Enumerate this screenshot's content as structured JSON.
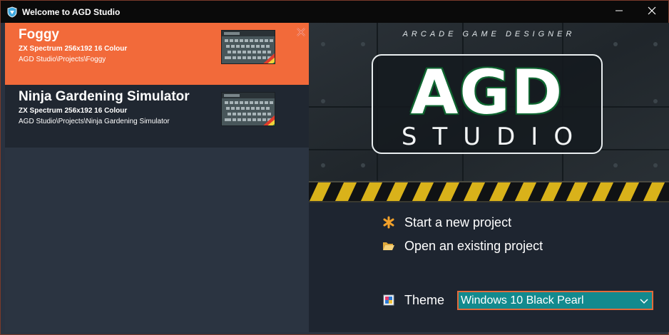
{
  "window": {
    "title": "Welcome to AGD Studio",
    "app_icon": "agd-shield-icon",
    "minimize_icon": "minimize-icon",
    "close_icon": "close-icon"
  },
  "projects": [
    {
      "name": "Foggy",
      "platform": "ZX Spectrum 256x192 16 Colour",
      "path": "AGD Studio\\Projects\\Foggy",
      "selected": true,
      "remove_icon": "remove-icon"
    },
    {
      "name": "Ninja Gardening Simulator",
      "platform": "ZX Spectrum 256x192 16 Colour",
      "path": "AGD Studio\\Projects\\Ninja Gardening Simulator",
      "selected": false
    }
  ],
  "banner": {
    "tagline": "ARCADE GAME DESIGNER",
    "logo_main": "AGD",
    "logo_sub": "STUDIO"
  },
  "actions": {
    "new_project": {
      "label": "Start a new project",
      "icon": "asterisk-icon"
    },
    "open_project": {
      "label": "Open an existing project",
      "icon": "folder-open-icon"
    }
  },
  "theme": {
    "label": "Theme",
    "icon": "palette-icon",
    "selected": "Windows 10 Black Pearl"
  },
  "colors": {
    "accent_orange": "#f26a3a",
    "window_bg": "#2a3240",
    "list_bg": "#202731",
    "select_bg": "#128a8e",
    "select_border": "#e26a3a"
  }
}
